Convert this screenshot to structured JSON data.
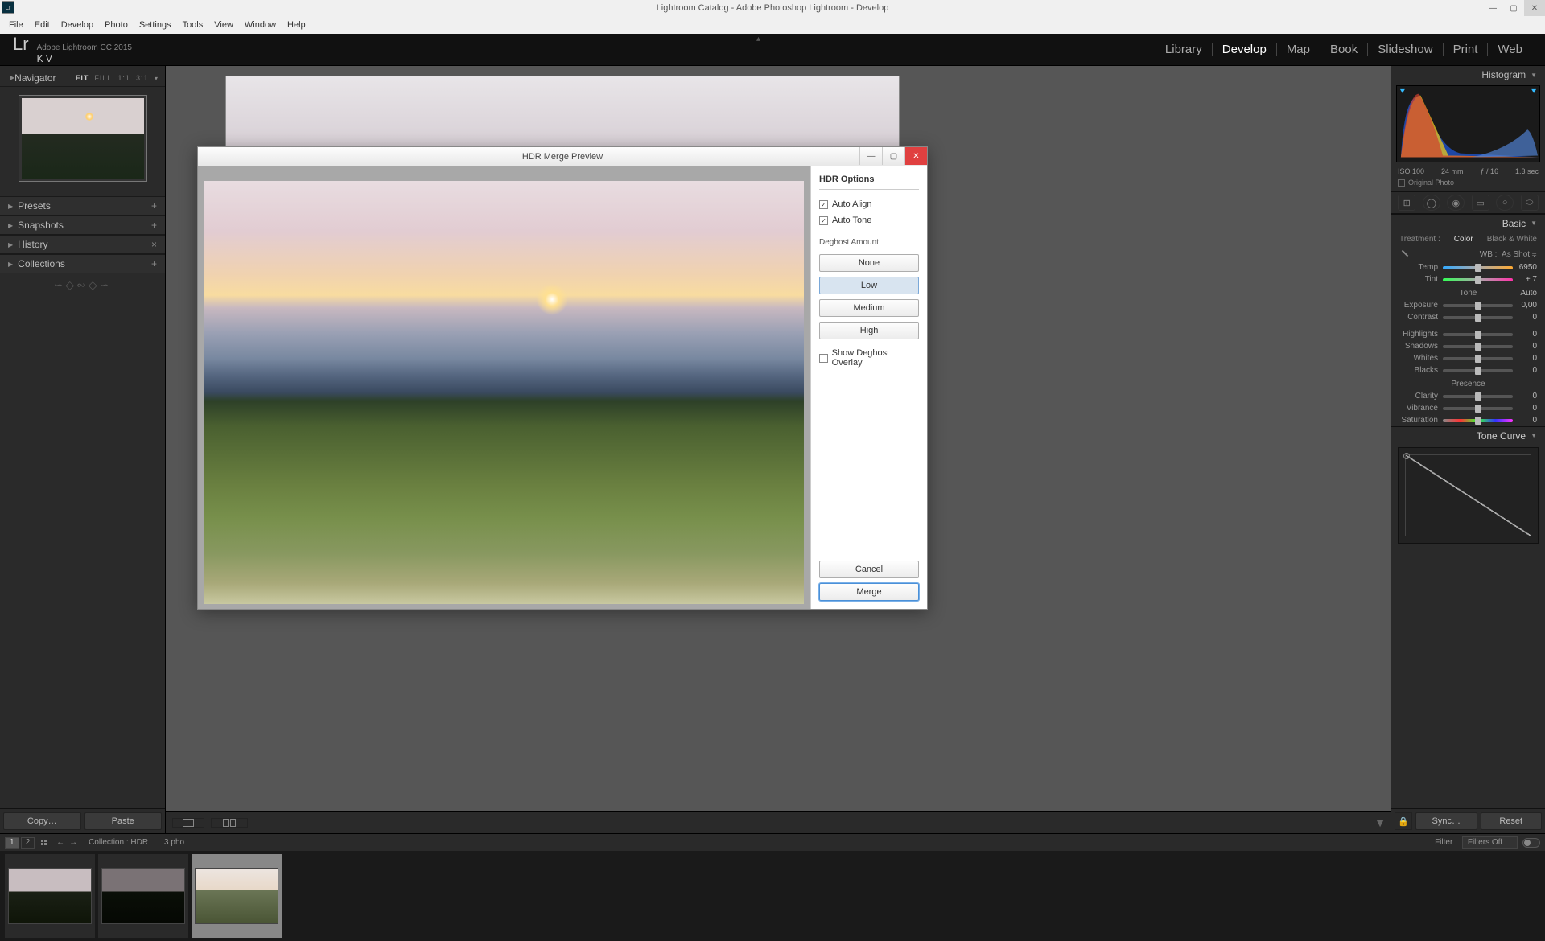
{
  "titlebar": {
    "text": "Lightroom Catalog - Adobe Photoshop Lightroom - Develop",
    "appicon": "Lr"
  },
  "menu": [
    "File",
    "Edit",
    "Develop",
    "Photo",
    "Settings",
    "Tools",
    "View",
    "Window",
    "Help"
  ],
  "identity": {
    "product": "Adobe Lightroom CC 2015",
    "user": "K V"
  },
  "modules": [
    "Library",
    "Develop",
    "Map",
    "Book",
    "Slideshow",
    "Print",
    "Web"
  ],
  "active_module": "Develop",
  "left": {
    "navigator": "Navigator",
    "nav_opts": [
      "FIT",
      "FILL",
      "1:1",
      "3:1"
    ],
    "nav_active": "FIT",
    "sections": [
      "Presets",
      "Snapshots",
      "History",
      "Collections"
    ],
    "copy": "Copy…",
    "paste": "Paste"
  },
  "right": {
    "histogram": "Histogram",
    "meta": {
      "iso": "ISO 100",
      "focal": "24 mm",
      "aperture": "ƒ / 16",
      "shutter": "1.3 sec"
    },
    "original": "Original Photo",
    "basic": "Basic",
    "treatment": "Treatment :",
    "color": "Color",
    "bw": "Black & White",
    "wb_label": "WB :",
    "wb_value": "As Shot",
    "sliders": {
      "Temp": "6950",
      "Tint": "+ 7",
      "tone_hdr": "Tone",
      "auto": "Auto",
      "Exposure": "0,00",
      "Contrast": "0",
      "Highlights": "0",
      "Shadows": "0",
      "Whites": "0",
      "Blacks": "0",
      "presence": "Presence",
      "Clarity": "0",
      "Vibrance": "0",
      "Saturation": "0"
    },
    "tonecurve": "Tone Curve",
    "sync": "Sync…",
    "reset": "Reset"
  },
  "filmstrip": {
    "pages": [
      "1",
      "2"
    ],
    "collection": "Collection : HDR",
    "count": "3 pho",
    "filter_label": "Filter :",
    "filter_value": "Filters Off"
  },
  "dialog": {
    "title": "HDR Merge Preview",
    "hdr_options": "HDR Options",
    "auto_align": "Auto Align",
    "auto_tone": "Auto Tone",
    "deghost_label": "Deghost Amount",
    "levels": [
      "None",
      "Low",
      "Medium",
      "High"
    ],
    "selected": "Low",
    "overlay": "Show Deghost Overlay",
    "cancel": "Cancel",
    "merge": "Merge"
  }
}
